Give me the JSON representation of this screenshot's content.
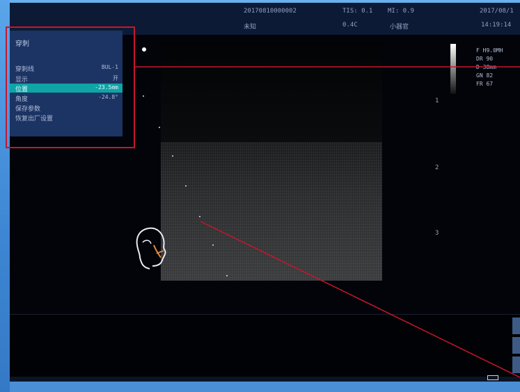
{
  "header": {
    "patient_id": "20170810000002",
    "tis": "TIS: 0.1",
    "mi": "MI: 0.9",
    "date": "2017/08/1",
    "org_label": "未知",
    "preset_value": "0.4C",
    "preset_name": "小器官",
    "time": "14:19:14"
  },
  "menu": {
    "title": "穿刺",
    "items": [
      {
        "label": "穿刺线",
        "value": "BUL-1",
        "selected": false
      },
      {
        "label": "显示",
        "value": "开",
        "selected": false
      },
      {
        "label": "位置",
        "value": "-23.5mm",
        "selected": true
      },
      {
        "label": "角度",
        "value": "-24.8°",
        "selected": false
      },
      {
        "label": "保存参数",
        "value": "",
        "selected": false
      },
      {
        "label": "恢复出厂设置",
        "value": "",
        "selected": false
      }
    ]
  },
  "image_info": {
    "f": "F   H9.0MH",
    "dr": "DR  90",
    "d": "D   38mm",
    "gn": "GN  82",
    "fr": "FR  67"
  },
  "depth_marks": [
    "1",
    "2",
    "3"
  ],
  "colors": {
    "menu_bg": "#1c3463",
    "selected": "#0fa4a6",
    "annotation_red": "#c8162b"
  }
}
